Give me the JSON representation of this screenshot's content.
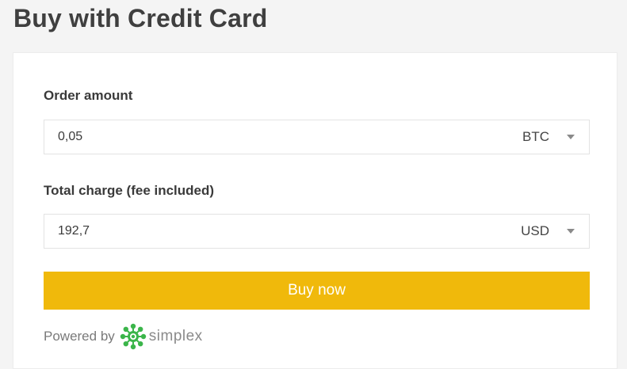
{
  "page": {
    "title": "Buy with Credit Card"
  },
  "order": {
    "label": "Order amount",
    "value": "0,05",
    "currency": "BTC"
  },
  "total": {
    "label": "Total charge (fee included)",
    "value": "192,7",
    "currency": "USD"
  },
  "actions": {
    "buy_label": "Buy now"
  },
  "footer": {
    "powered_by": "Powered by",
    "brand": "simplex",
    "brand_icon": "simplex-logo-icon"
  },
  "colors": {
    "accent": "#f0b90b",
    "brand_green": "#3bb54a"
  }
}
